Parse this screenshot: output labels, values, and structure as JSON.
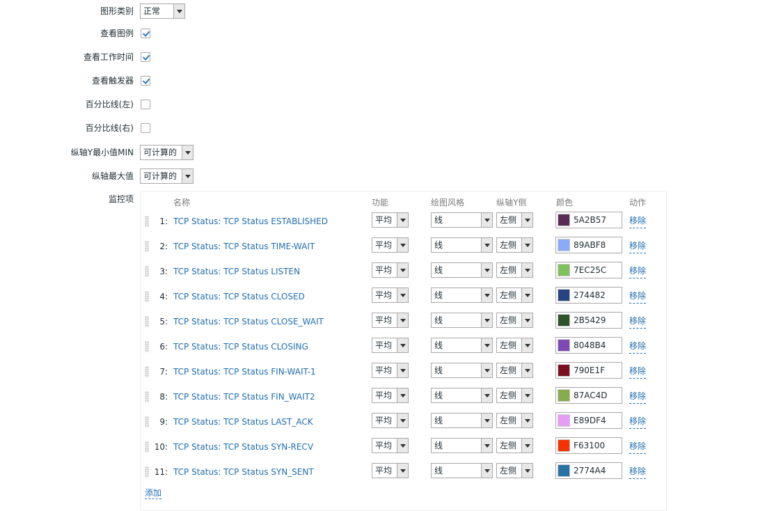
{
  "form": {
    "graph_type": {
      "label": "图形类别",
      "value": "正常"
    },
    "show_legend": {
      "label": "查看图例",
      "checked": true
    },
    "show_working_time": {
      "label": "查看工作时间",
      "checked": true
    },
    "show_triggers": {
      "label": "查看触发器",
      "checked": true
    },
    "percentile_left": {
      "label": "百分比线(左)",
      "checked": false
    },
    "percentile_right": {
      "label": "百分比线(右)",
      "checked": false
    },
    "y_min": {
      "label": "纵轴Y最小值MIN",
      "value": "可计算的"
    },
    "y_max": {
      "label": "纵轴最大值",
      "value": "可计算的"
    }
  },
  "items_section": {
    "label": "监控项",
    "headers": {
      "name": "名称",
      "function": "功能",
      "draw_style": "绘图风格",
      "y_axis_side": "纵轴Y侧",
      "color": "颜色",
      "action": "动作"
    },
    "add_label": "添加",
    "items": [
      {
        "num": "1:",
        "name": "TCP Status: TCP Status ESTABLISHED",
        "function": "平均",
        "draw_style": "线",
        "y_axis_side": "左侧",
        "color": "5A2B57",
        "remove": "移除"
      },
      {
        "num": "2:",
        "name": "TCP Status: TCP Status TIME-WAIT",
        "function": "平均",
        "draw_style": "线",
        "y_axis_side": "左侧",
        "color": "89ABF8",
        "remove": "移除"
      },
      {
        "num": "3:",
        "name": "TCP Status: TCP Status LISTEN",
        "function": "平均",
        "draw_style": "线",
        "y_axis_side": "左侧",
        "color": "7EC25C",
        "remove": "移除"
      },
      {
        "num": "4:",
        "name": "TCP Status: TCP Status CLOSED",
        "function": "平均",
        "draw_style": "线",
        "y_axis_side": "左侧",
        "color": "274482",
        "remove": "移除"
      },
      {
        "num": "5:",
        "name": "TCP Status: TCP Status CLOSE_WAIT",
        "function": "平均",
        "draw_style": "线",
        "y_axis_side": "左侧",
        "color": "2B5429",
        "remove": "移除"
      },
      {
        "num": "6:",
        "name": "TCP Status: TCP Status CLOSING",
        "function": "平均",
        "draw_style": "线",
        "y_axis_side": "左侧",
        "color": "8048B4",
        "remove": "移除"
      },
      {
        "num": "7:",
        "name": "TCP Status: TCP Status FIN-WAIT-1",
        "function": "平均",
        "draw_style": "线",
        "y_axis_side": "左侧",
        "color": "790E1F",
        "remove": "移除"
      },
      {
        "num": "8:",
        "name": "TCP Status: TCP Status FIN_WAIT2",
        "function": "平均",
        "draw_style": "线",
        "y_axis_side": "左侧",
        "color": "87AC4D",
        "remove": "移除"
      },
      {
        "num": "9:",
        "name": "TCP Status: TCP Status LAST_ACK",
        "function": "平均",
        "draw_style": "线",
        "y_axis_side": "左侧",
        "color": "E89DF4",
        "remove": "移除"
      },
      {
        "num": "10:",
        "name": "TCP Status: TCP Status SYN-RECV",
        "function": "平均",
        "draw_style": "线",
        "y_axis_side": "左侧",
        "color": "F63100",
        "remove": "移除"
      },
      {
        "num": "11:",
        "name": "TCP Status: TCP Status SYN_SENT",
        "function": "平均",
        "draw_style": "线",
        "y_axis_side": "左侧",
        "color": "2774A4",
        "remove": "移除"
      }
    ]
  }
}
